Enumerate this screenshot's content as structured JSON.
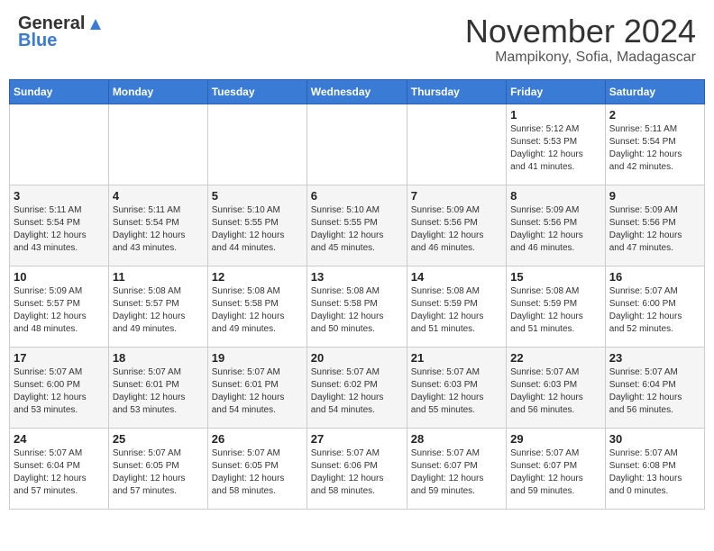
{
  "logo": {
    "general": "General",
    "blue": "Blue"
  },
  "title": "November 2024",
  "location": "Mampikony, Sofia, Madagascar",
  "weekdays": [
    "Sunday",
    "Monday",
    "Tuesday",
    "Wednesday",
    "Thursday",
    "Friday",
    "Saturday"
  ],
  "weeks": [
    [
      {
        "day": "",
        "info": ""
      },
      {
        "day": "",
        "info": ""
      },
      {
        "day": "",
        "info": ""
      },
      {
        "day": "",
        "info": ""
      },
      {
        "day": "",
        "info": ""
      },
      {
        "day": "1",
        "info": "Sunrise: 5:12 AM\nSunset: 5:53 PM\nDaylight: 12 hours\nand 41 minutes."
      },
      {
        "day": "2",
        "info": "Sunrise: 5:11 AM\nSunset: 5:54 PM\nDaylight: 12 hours\nand 42 minutes."
      }
    ],
    [
      {
        "day": "3",
        "info": "Sunrise: 5:11 AM\nSunset: 5:54 PM\nDaylight: 12 hours\nand 43 minutes."
      },
      {
        "day": "4",
        "info": "Sunrise: 5:11 AM\nSunset: 5:54 PM\nDaylight: 12 hours\nand 43 minutes."
      },
      {
        "day": "5",
        "info": "Sunrise: 5:10 AM\nSunset: 5:55 PM\nDaylight: 12 hours\nand 44 minutes."
      },
      {
        "day": "6",
        "info": "Sunrise: 5:10 AM\nSunset: 5:55 PM\nDaylight: 12 hours\nand 45 minutes."
      },
      {
        "day": "7",
        "info": "Sunrise: 5:09 AM\nSunset: 5:56 PM\nDaylight: 12 hours\nand 46 minutes."
      },
      {
        "day": "8",
        "info": "Sunrise: 5:09 AM\nSunset: 5:56 PM\nDaylight: 12 hours\nand 46 minutes."
      },
      {
        "day": "9",
        "info": "Sunrise: 5:09 AM\nSunset: 5:56 PM\nDaylight: 12 hours\nand 47 minutes."
      }
    ],
    [
      {
        "day": "10",
        "info": "Sunrise: 5:09 AM\nSunset: 5:57 PM\nDaylight: 12 hours\nand 48 minutes."
      },
      {
        "day": "11",
        "info": "Sunrise: 5:08 AM\nSunset: 5:57 PM\nDaylight: 12 hours\nand 49 minutes."
      },
      {
        "day": "12",
        "info": "Sunrise: 5:08 AM\nSunset: 5:58 PM\nDaylight: 12 hours\nand 49 minutes."
      },
      {
        "day": "13",
        "info": "Sunrise: 5:08 AM\nSunset: 5:58 PM\nDaylight: 12 hours\nand 50 minutes."
      },
      {
        "day": "14",
        "info": "Sunrise: 5:08 AM\nSunset: 5:59 PM\nDaylight: 12 hours\nand 51 minutes."
      },
      {
        "day": "15",
        "info": "Sunrise: 5:08 AM\nSunset: 5:59 PM\nDaylight: 12 hours\nand 51 minutes."
      },
      {
        "day": "16",
        "info": "Sunrise: 5:07 AM\nSunset: 6:00 PM\nDaylight: 12 hours\nand 52 minutes."
      }
    ],
    [
      {
        "day": "17",
        "info": "Sunrise: 5:07 AM\nSunset: 6:00 PM\nDaylight: 12 hours\nand 53 minutes."
      },
      {
        "day": "18",
        "info": "Sunrise: 5:07 AM\nSunset: 6:01 PM\nDaylight: 12 hours\nand 53 minutes."
      },
      {
        "day": "19",
        "info": "Sunrise: 5:07 AM\nSunset: 6:01 PM\nDaylight: 12 hours\nand 54 minutes."
      },
      {
        "day": "20",
        "info": "Sunrise: 5:07 AM\nSunset: 6:02 PM\nDaylight: 12 hours\nand 54 minutes."
      },
      {
        "day": "21",
        "info": "Sunrise: 5:07 AM\nSunset: 6:03 PM\nDaylight: 12 hours\nand 55 minutes."
      },
      {
        "day": "22",
        "info": "Sunrise: 5:07 AM\nSunset: 6:03 PM\nDaylight: 12 hours\nand 56 minutes."
      },
      {
        "day": "23",
        "info": "Sunrise: 5:07 AM\nSunset: 6:04 PM\nDaylight: 12 hours\nand 56 minutes."
      }
    ],
    [
      {
        "day": "24",
        "info": "Sunrise: 5:07 AM\nSunset: 6:04 PM\nDaylight: 12 hours\nand 57 minutes."
      },
      {
        "day": "25",
        "info": "Sunrise: 5:07 AM\nSunset: 6:05 PM\nDaylight: 12 hours\nand 57 minutes."
      },
      {
        "day": "26",
        "info": "Sunrise: 5:07 AM\nSunset: 6:05 PM\nDaylight: 12 hours\nand 58 minutes."
      },
      {
        "day": "27",
        "info": "Sunrise: 5:07 AM\nSunset: 6:06 PM\nDaylight: 12 hours\nand 58 minutes."
      },
      {
        "day": "28",
        "info": "Sunrise: 5:07 AM\nSunset: 6:07 PM\nDaylight: 12 hours\nand 59 minutes."
      },
      {
        "day": "29",
        "info": "Sunrise: 5:07 AM\nSunset: 6:07 PM\nDaylight: 12 hours\nand 59 minutes."
      },
      {
        "day": "30",
        "info": "Sunrise: 5:07 AM\nSunset: 6:08 PM\nDaylight: 13 hours\nand 0 minutes."
      }
    ]
  ]
}
